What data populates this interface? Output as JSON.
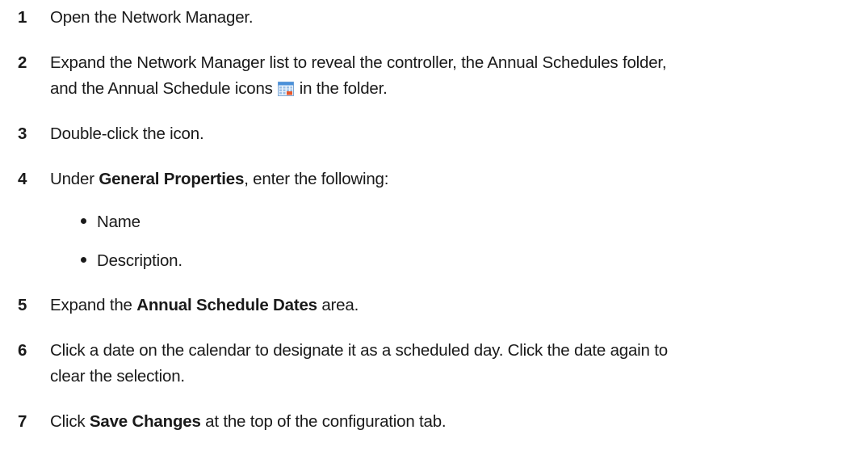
{
  "steps": [
    {
      "number": "1",
      "text": "Open the Network Manager."
    },
    {
      "number": "2",
      "text_a": "Expand the Network Manager list to reveal the controller, the Annual Schedules folder,",
      "text_b": "and the Annual Schedule icons",
      "text_c": "in the folder."
    },
    {
      "number": "3",
      "text": "Double-click the icon."
    },
    {
      "number": "4",
      "text_a": "Under ",
      "bold": "General Properties",
      "text_b": ", enter the following:"
    },
    {
      "number": "5",
      "text_a": "Expand the ",
      "bold": "Annual Schedule Dates",
      "text_b": " area."
    },
    {
      "number": "6",
      "text_a": "Click a date on the calendar to designate it as a scheduled day. Click the date again to",
      "text_b": "clear the selection."
    },
    {
      "number": "7",
      "text_a": "Click ",
      "bold": "Save Changes",
      "text_b": " at the top of the configuration tab."
    }
  ],
  "bullets": [
    "Name",
    "Description."
  ],
  "icon": {
    "name": "annual-schedule-icon",
    "accent": "#e8572a",
    "grid": "#4a90d9"
  }
}
